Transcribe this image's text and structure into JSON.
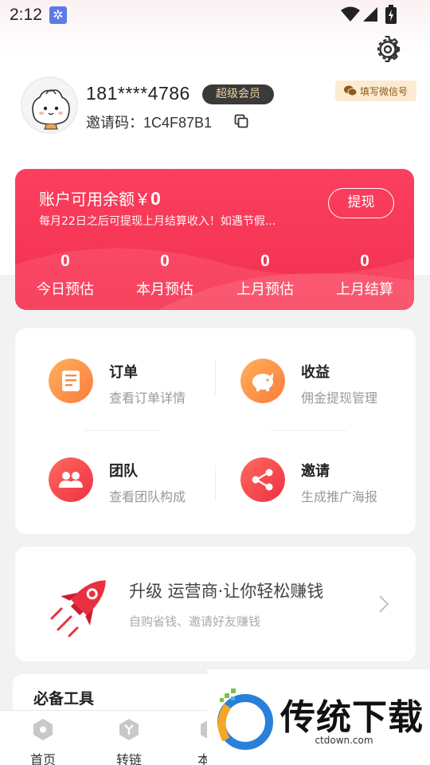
{
  "status_bar": {
    "time": "2:12"
  },
  "header": {
    "settings_icon": "gear-icon",
    "wechat_button_label": "填写微信号",
    "phone": "181****4786",
    "member_badge": "超级会员",
    "invite_label": "邀请码：",
    "invite_code": "1C4F87B1"
  },
  "balance": {
    "title": "账户可用余额￥",
    "amount": "0",
    "note": "每月22日之后可提现上月结算收入！如遇节假...",
    "withdraw_label": "提现",
    "stats": [
      {
        "value": "0",
        "label": "今日预估"
      },
      {
        "value": "0",
        "label": "本月预估"
      },
      {
        "value": "0",
        "label": "上月预估"
      },
      {
        "value": "0",
        "label": "上月结算"
      }
    ]
  },
  "menu": [
    {
      "title": "订单",
      "subtitle": "查看订单详情",
      "icon": "order-icon",
      "color": "#fb8a4a"
    },
    {
      "title": "收益",
      "subtitle": "佣金提现管理",
      "icon": "piggy-bank-icon",
      "color": "#fb8a4a"
    },
    {
      "title": "团队",
      "subtitle": "查看团队构成",
      "icon": "team-icon",
      "color": "#f03e46"
    },
    {
      "title": "邀请",
      "subtitle": "生成推广海报",
      "icon": "share-icon",
      "color": "#f03e46"
    }
  ],
  "upgrade": {
    "title": "升级 运营商·让你轻松赚钱",
    "subtitle": "自购省钱、邀请好友赚钱",
    "icon": "rocket-icon"
  },
  "tools": {
    "title": "必备工具"
  },
  "nav": [
    {
      "label": "首页",
      "icon": "home-icon"
    },
    {
      "label": "转链",
      "icon": "link-icon"
    },
    {
      "label": "本地",
      "icon": "local-icon"
    }
  ],
  "watermark": {
    "brand": "传统下载",
    "url": "ctdown.com"
  },
  "colors": {
    "accent": "#f2304f",
    "badge_bg": "#3a3a3a",
    "badge_text": "#f0d49a"
  }
}
